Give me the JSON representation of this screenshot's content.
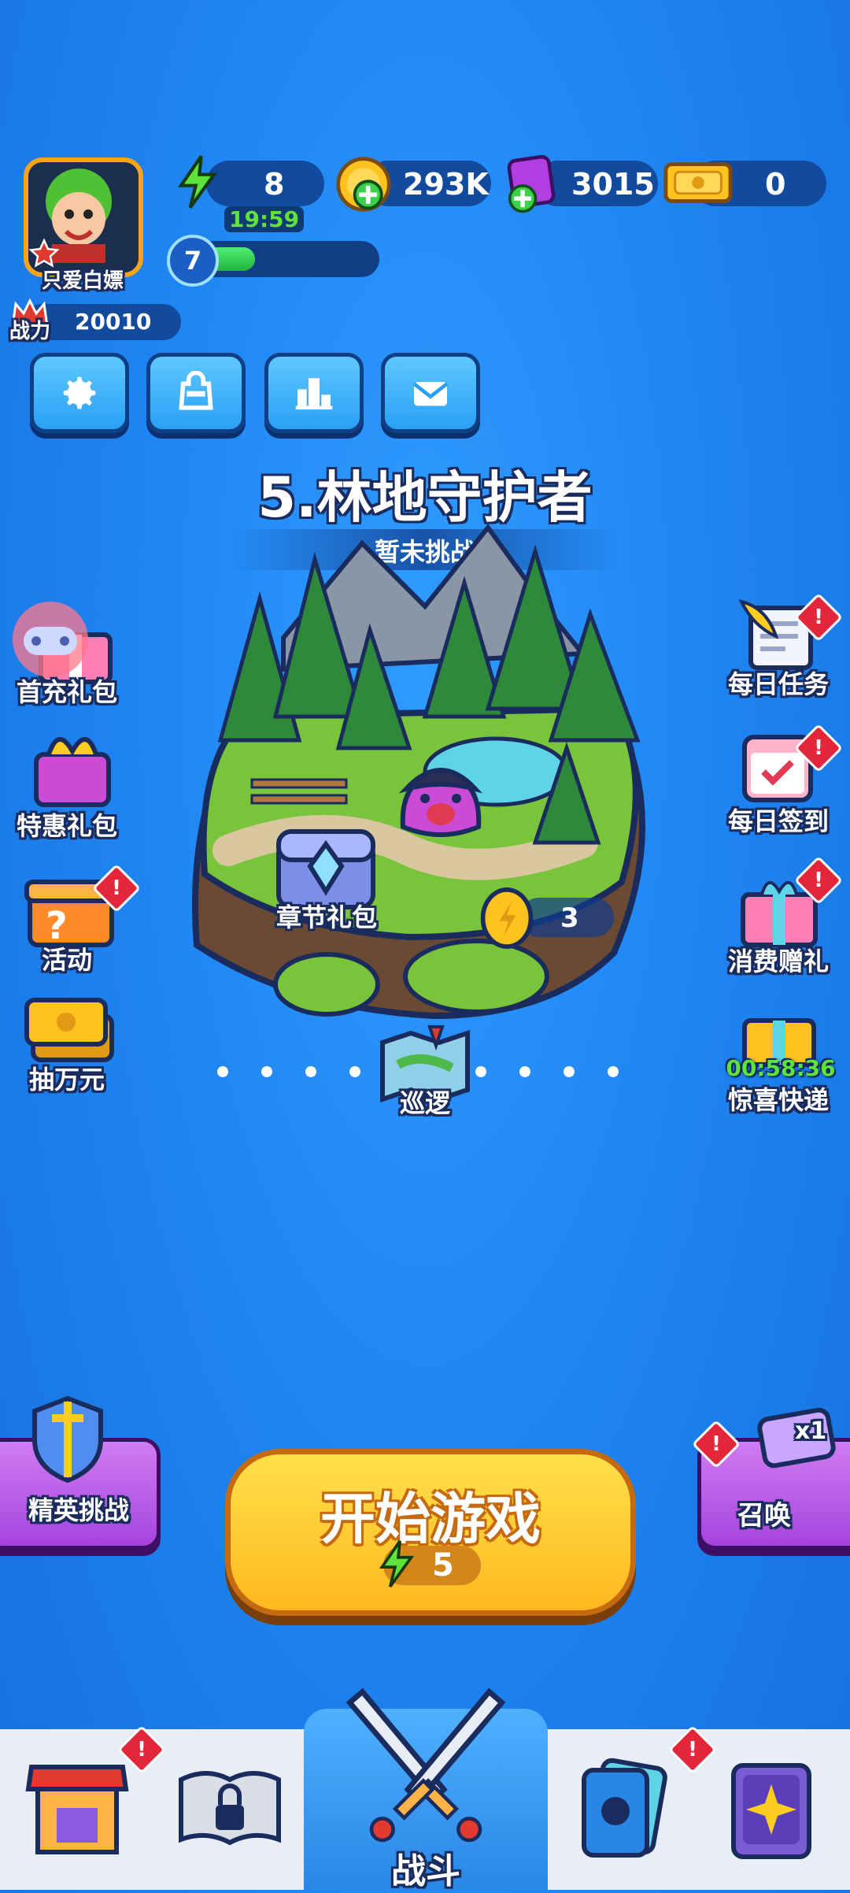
{
  "player": {
    "name": "只爱白嫖",
    "power_label": "战力",
    "power_value": "20010",
    "level": "7",
    "exp_progress": 0.3
  },
  "resources": {
    "energy": {
      "value": "8",
      "timer": "19:59",
      "icon": "lightning-icon"
    },
    "coins": {
      "value": "293K",
      "icon": "coin-plus-icon"
    },
    "gems": {
      "value": "3015",
      "icon": "gem-plus-icon"
    },
    "tickets": {
      "value": "0",
      "icon": "ticket-icon"
    }
  },
  "toolbar": [
    "gear-icon",
    "bag-icon",
    "ranking-icon",
    "mail-icon"
  ],
  "stage": {
    "title": "5.林地守护者",
    "status": "暂未挑战",
    "chest_label": "章节礼包",
    "coin_reward": "3",
    "patrol_label": "巡逻"
  },
  "left_menu": [
    {
      "label": "首充礼包"
    },
    {
      "label": "特惠礼包"
    },
    {
      "label": "活动"
    },
    {
      "label": "抽万元"
    }
  ],
  "right_menu": [
    {
      "label": "每日任务"
    },
    {
      "label": "每日签到"
    },
    {
      "label": "消费赠礼"
    },
    {
      "label": "惊喜快递",
      "timer": "00:58:36"
    }
  ],
  "elite_challenge": {
    "label": "精英挑战"
  },
  "summon": {
    "label": "召唤",
    "badge": "x1"
  },
  "start_game": {
    "label": "开始游戏",
    "cost": "5"
  },
  "bottom_nav": {
    "battle_label": "战斗"
  },
  "alert_mark": "!",
  "colors": {
    "start_button": "#ffcc1f",
    "summon_button": "#b85be8",
    "elite_button": "#b85be8",
    "nav_active": "#3fa0ff"
  }
}
